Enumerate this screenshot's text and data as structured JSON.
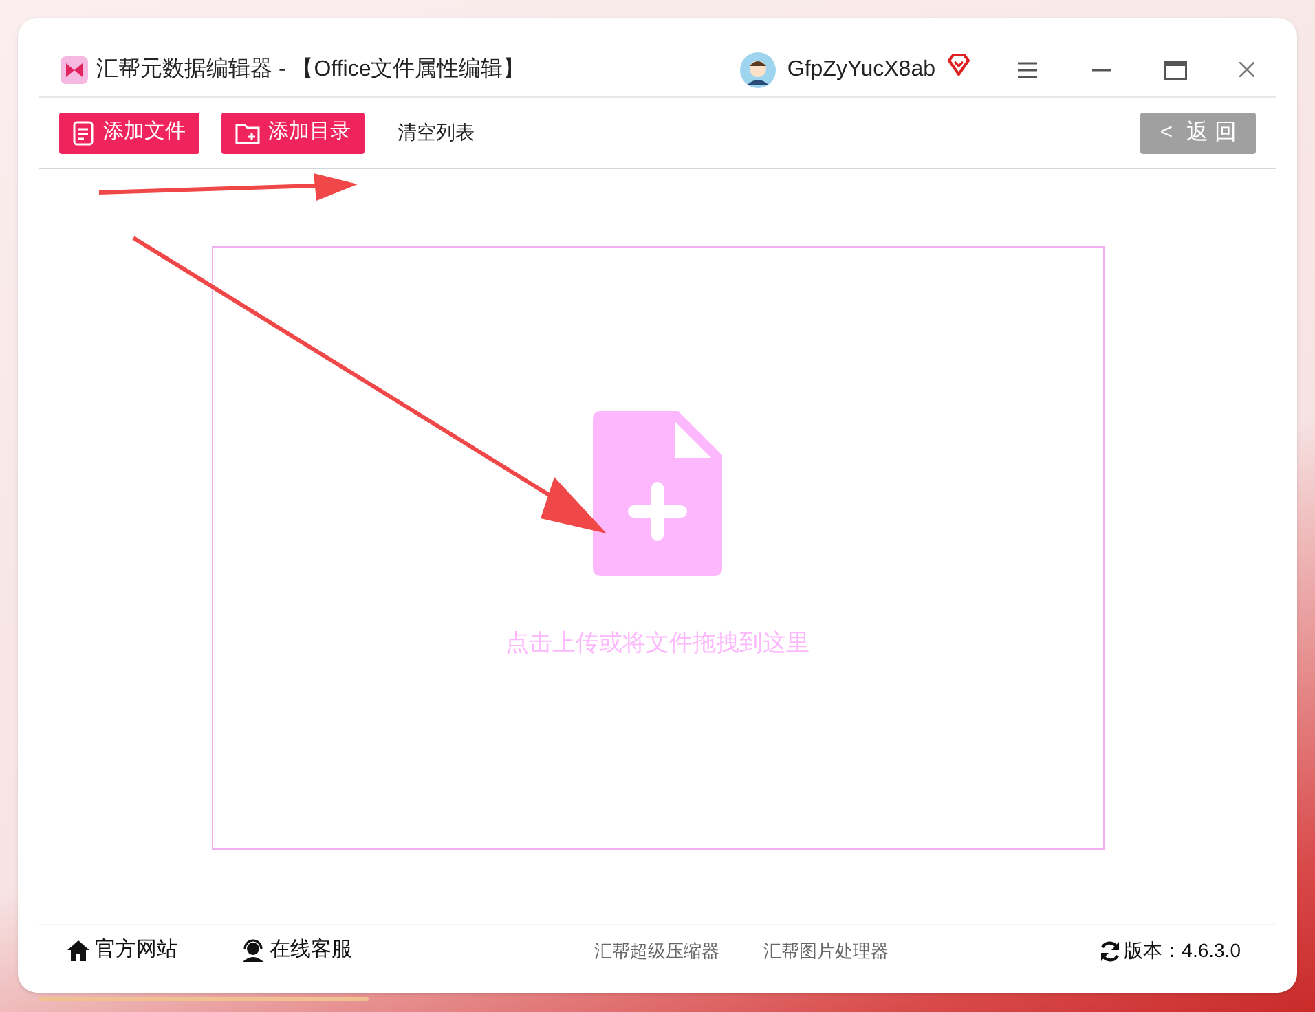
{
  "window": {
    "title": "汇帮元数据编辑器 - 【Office文件属性编辑】",
    "user": "GfpZyYucX8ab"
  },
  "toolbar": {
    "buttons": [
      {
        "kind": "file",
        "label": "添加文件"
      },
      {
        "kind": "folder",
        "label": "添加目录"
      },
      {
        "kind": "plain",
        "label": "清空列表"
      }
    ],
    "back": {
      "icon": "<",
      "label": "返 回"
    }
  },
  "dropzone": {
    "hint": "点击上传或将文件拖拽到这里"
  },
  "footer": {
    "links": [
      {
        "kind": "home",
        "label": "官方网站"
      },
      {
        "kind": "support",
        "label": "在线客服"
      }
    ],
    "apps": [
      "汇帮超级压缩器",
      "汇帮图片处理器"
    ],
    "version": "版本：4.6.3.0"
  }
}
